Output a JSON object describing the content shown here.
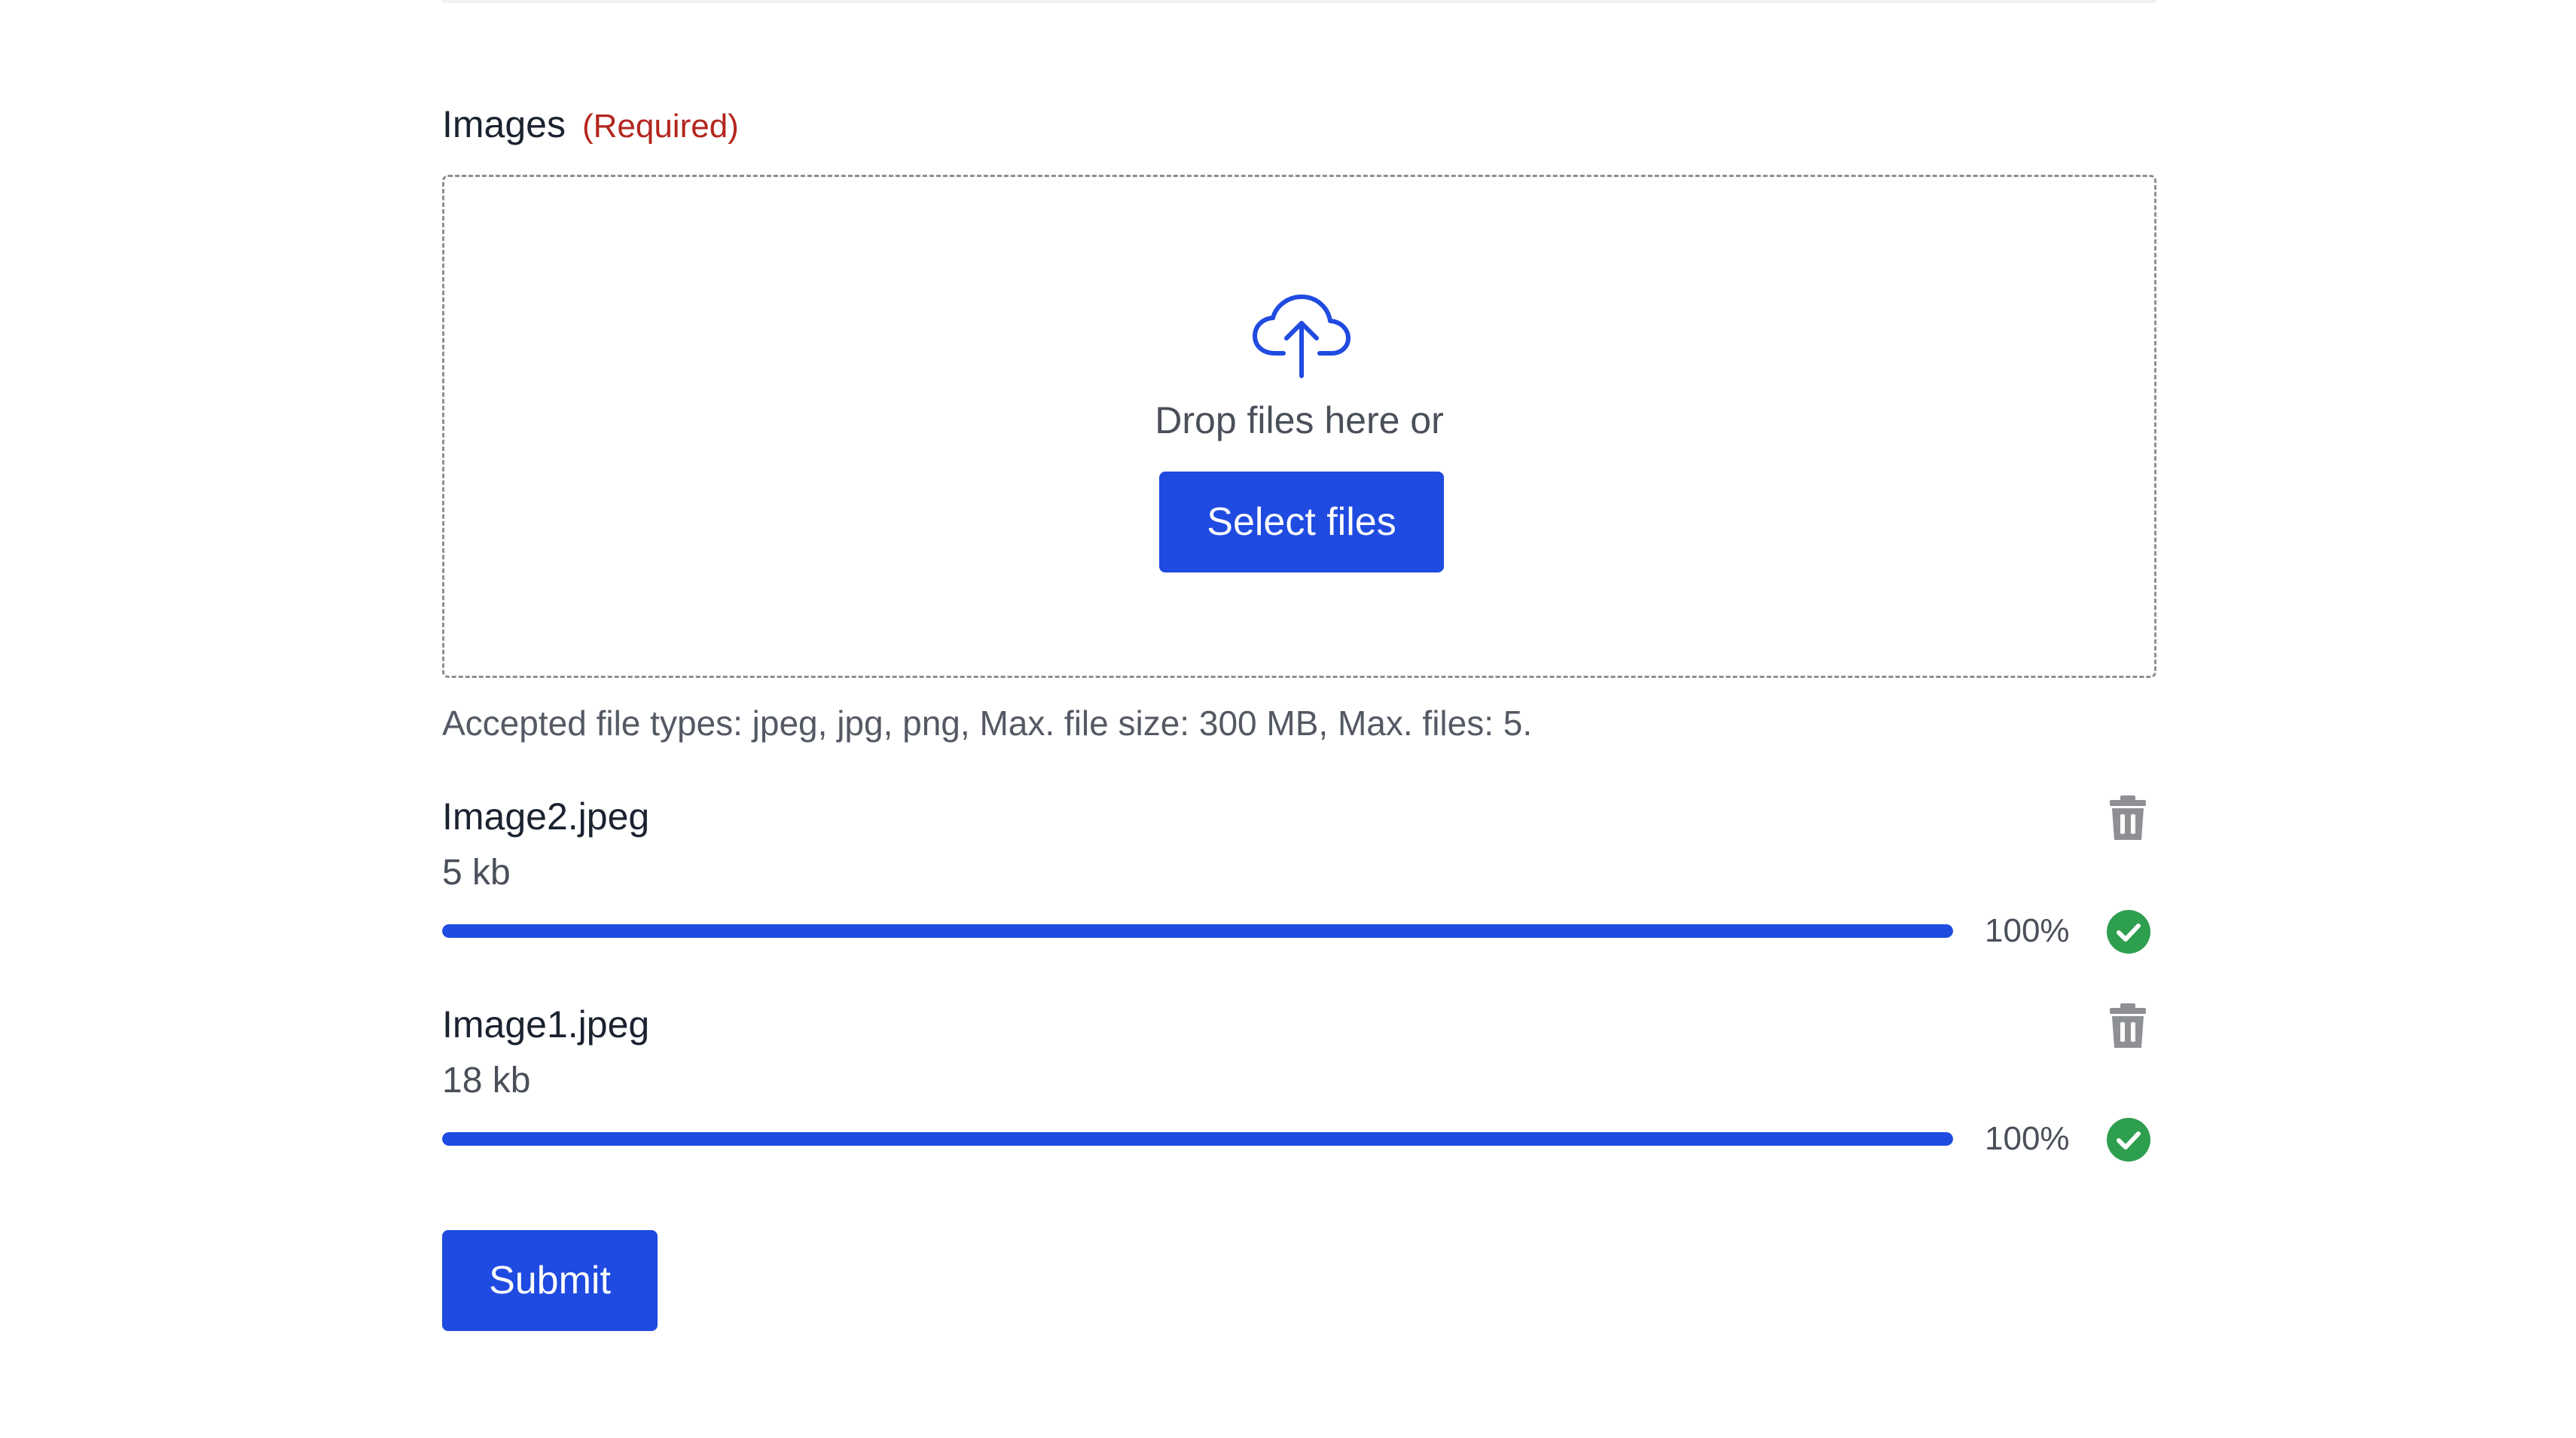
{
  "images_field": {
    "label": "Images",
    "required_text": "(Required)",
    "required_color": "#b3261e"
  },
  "dropzone": {
    "icon": "cloud-upload-icon",
    "prompt": "Drop files here or",
    "select_button_label": "Select files"
  },
  "hint": "Accepted file types: jpeg, jpg, png, Max. file size: 300 MB, Max. files: 5.",
  "files": [
    {
      "name": "Image2.jpeg",
      "size": "5 kb",
      "progress": 1.0,
      "percent_label": "100%",
      "status_icon": "check-circle-icon",
      "delete_icon": "trash-icon"
    },
    {
      "name": "Image1.jpeg",
      "size": "18 kb",
      "progress": 1.0,
      "percent_label": "100%",
      "status_icon": "check-circle-icon",
      "delete_icon": "trash-icon"
    }
  ],
  "submit_label": "Submit",
  "colors": {
    "accent": "#1f4be0",
    "success": "#2e9e4f",
    "delete": "#8e9094",
    "progress_track": "#dde2f2"
  }
}
